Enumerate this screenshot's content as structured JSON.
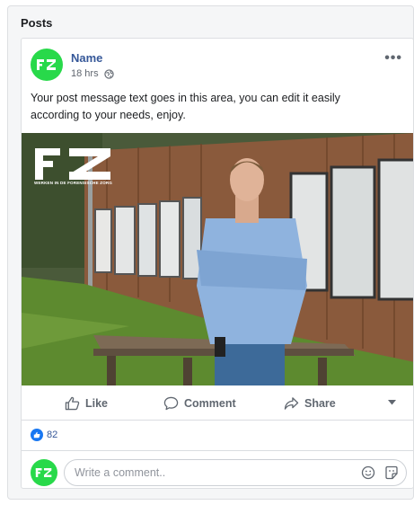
{
  "section": {
    "title": "Posts"
  },
  "post": {
    "author": "Name",
    "time": "18 hrs",
    "privacy_icon": "globe-icon",
    "message": "Your post message text goes in this area, you can edit it easily according to your needs, enjoy.",
    "more_label": "•••",
    "image": {
      "logo_text": "FZ",
      "logo_tagline": "WERKEN IN DE FORENSISCHE ZORG"
    }
  },
  "actions": {
    "like": "Like",
    "comment": "Comment",
    "share": "Share"
  },
  "reactions": {
    "count": "82"
  },
  "comment_input": {
    "placeholder": "Write a comment.."
  },
  "colors": {
    "brand_green": "#28d94a",
    "link_blue": "#365899",
    "like_blue": "#1877f2"
  }
}
